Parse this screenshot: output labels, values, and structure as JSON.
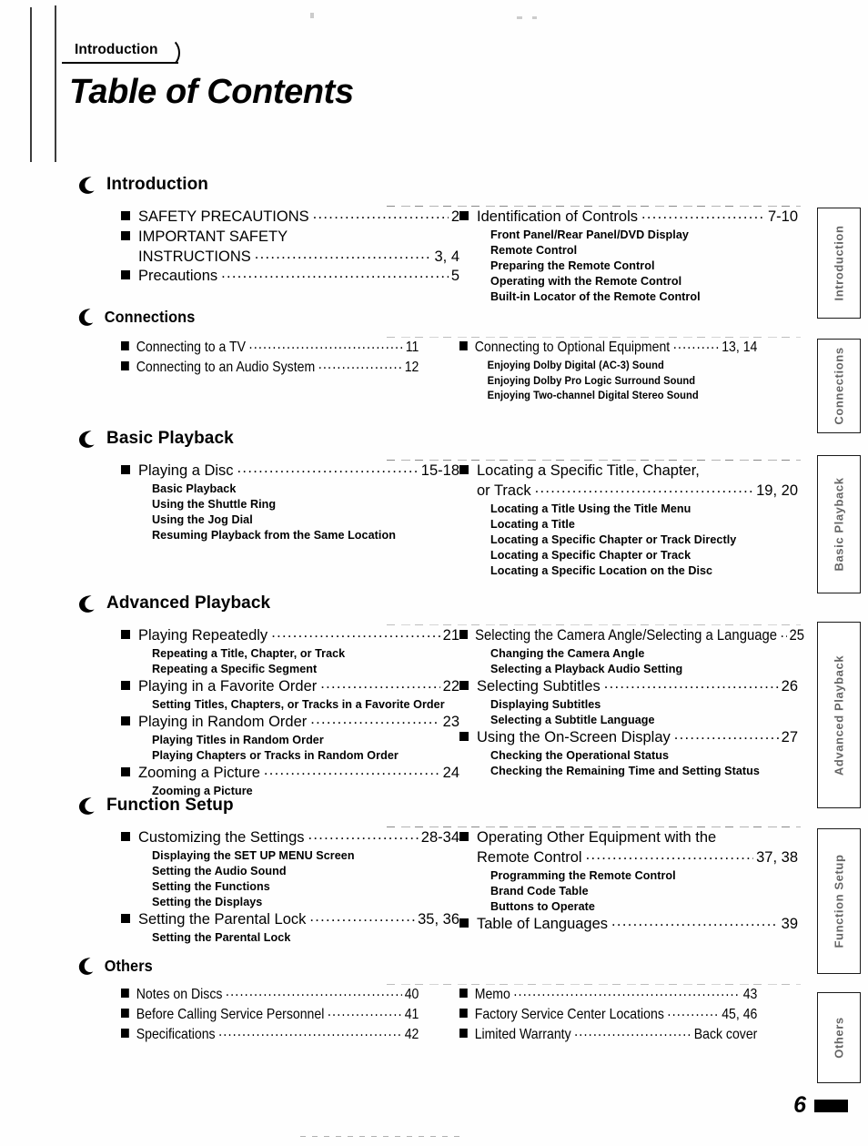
{
  "header": {
    "tab_label": "Introduction",
    "title": "Table of Contents"
  },
  "footer": {
    "page_number": "6"
  },
  "thumb_tabs": [
    {
      "label": "Introduction"
    },
    {
      "label": "Connections"
    },
    {
      "label": "Basic Playback"
    },
    {
      "label": "Advanced Playback"
    },
    {
      "label": "Function Setup"
    },
    {
      "label": "Others"
    }
  ],
  "sections": [
    {
      "title": "Introduction",
      "left": [
        {
          "title": "SAFETY PRECAUTIONS",
          "page": "2",
          "subs": []
        },
        {
          "title": "IMPORTANT SAFETY",
          "title_cont": "INSTRUCTIONS",
          "page": "3, 4",
          "subs": []
        },
        {
          "title": "Precautions",
          "page": "5",
          "subs": []
        }
      ],
      "right": [
        {
          "title": "Identification of Controls",
          "page": "7-10",
          "subs": [
            "Front Panel/Rear Panel/DVD Display",
            "Remote Control",
            "Preparing the Remote Control",
            "Operating with the Remote Control",
            "Built-in Locator of the Remote Control"
          ]
        }
      ]
    },
    {
      "title": "Connections",
      "left": [
        {
          "title": "Connecting to a TV",
          "page": "11",
          "subs": []
        },
        {
          "title": "Connecting to an Audio System",
          "page": "12",
          "subs": []
        }
      ],
      "right": [
        {
          "title": "Connecting to Optional Equipment",
          "page": "13, 14",
          "subs": [
            "Enjoying Dolby Digital (AC-3) Sound",
            "Enjoying Dolby Pro Logic Surround Sound",
            "Enjoying Two-channel Digital Stereo Sound"
          ]
        }
      ]
    },
    {
      "title": "Basic Playback",
      "left": [
        {
          "title": "Playing a Disc",
          "page": "15-18",
          "subs": [
            "Basic Playback",
            "Using the Shuttle Ring",
            "Using the Jog Dial",
            "Resuming Playback from the Same Location"
          ]
        }
      ],
      "right": [
        {
          "title": "Locating a Specific Title, Chapter,",
          "title_cont": "or Track",
          "page": "19, 20",
          "subs": [
            "Locating a Title Using the Title Menu",
            "Locating a Title",
            "Locating a Specific Chapter or Track Directly",
            "Locating a Specific Chapter or Track",
            "Locating a Specific Location on the Disc"
          ]
        }
      ]
    },
    {
      "title": "Advanced Playback",
      "left": [
        {
          "title": "Playing Repeatedly",
          "page": "21",
          "subs": [
            "Repeating a Title, Chapter, or Track",
            "Repeating a Specific Segment"
          ]
        },
        {
          "title": "Playing in a Favorite Order",
          "page": "22",
          "subs": [
            "Setting Titles, Chapters, or Tracks in a Favorite Order"
          ]
        },
        {
          "title": "Playing in Random Order",
          "page": "23",
          "subs": [
            "Playing Titles in Random Order",
            "Playing Chapters or Tracks in Random Order"
          ]
        },
        {
          "title": "Zooming a Picture",
          "page": "24",
          "subs": [
            "Zooming a Picture"
          ]
        }
      ],
      "right": [
        {
          "title": "Selecting the Camera Angle/Selecting a Language",
          "page": "25",
          "subs": [
            "Changing the Camera Angle",
            "Selecting a Playback Audio Setting"
          ]
        },
        {
          "title": "Selecting Subtitles",
          "page": "26",
          "subs": [
            "Displaying Subtitles",
            "Selecting a Subtitle Language"
          ]
        },
        {
          "title": "Using the On-Screen Display",
          "page": "27",
          "subs": [
            "Checking the Operational Status",
            "Checking the Remaining Time and Setting Status"
          ]
        }
      ]
    },
    {
      "title": "Function Setup",
      "left": [
        {
          "title": "Customizing the Settings",
          "page": "28-34",
          "subs": [
            "Displaying the SET UP MENU Screen",
            "Setting the Audio Sound",
            "Setting the Functions",
            "Setting the Displays"
          ]
        },
        {
          "title": "Setting the Parental Lock",
          "page": "35, 36",
          "subs": [
            "Setting the Parental Lock"
          ]
        }
      ],
      "right": [
        {
          "title": "Operating Other Equipment with the",
          "title_cont": "Remote Control",
          "page": "37, 38",
          "subs": [
            "Programming the Remote Control",
            "Brand Code Table",
            "Buttons to Operate"
          ]
        },
        {
          "title": "Table of Languages",
          "page": "39",
          "subs": []
        }
      ]
    },
    {
      "title": "Others",
      "left": [
        {
          "title": "Notes on Discs",
          "page": "40",
          "subs": []
        },
        {
          "title": "Before Calling Service Personnel",
          "page": "41",
          "subs": []
        },
        {
          "title": "Specifications",
          "page": "42",
          "subs": []
        }
      ],
      "right": [
        {
          "title": "Memo",
          "page": "43",
          "subs": []
        },
        {
          "title": "Factory Service Center Locations",
          "page": "45, 46",
          "subs": []
        },
        {
          "title": "Limited Warranty",
          "page": "Back cover",
          "subs": []
        }
      ]
    }
  ]
}
